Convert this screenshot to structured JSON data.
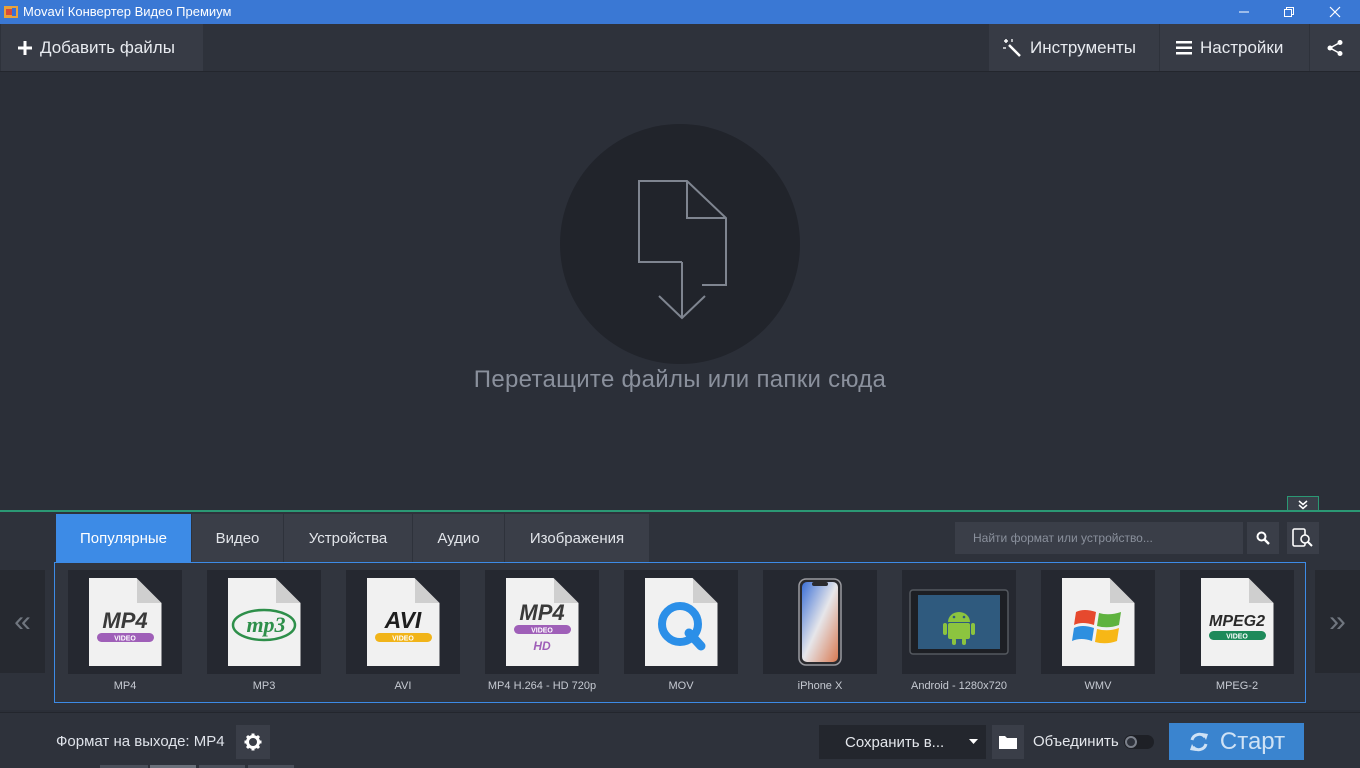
{
  "window": {
    "title": "Movavi Конвертер Видео Премиум"
  },
  "toolbar": {
    "add_files_label": "Добавить файлы",
    "tools_label": "Инструменты",
    "settings_label": "Настройки"
  },
  "drop_zone": {
    "hint": "Перетащите файлы или папки сюда"
  },
  "format_panel": {
    "tabs": [
      {
        "label": "Популярные",
        "active": true
      },
      {
        "label": "Видео",
        "active": false
      },
      {
        "label": "Устройства",
        "active": false
      },
      {
        "label": "Аудио",
        "active": false
      },
      {
        "label": "Изображения",
        "active": false
      }
    ],
    "search_placeholder": "Найти формат или устройство...",
    "prev_arrow": "«",
    "next_arrow": "»",
    "formats": [
      {
        "label": "MP4",
        "icon": "mp4-icon",
        "badge": "MP4",
        "sub": "VIDEO"
      },
      {
        "label": "MP3",
        "icon": "mp3-icon",
        "badge": "mp3"
      },
      {
        "label": "AVI",
        "icon": "avi-icon",
        "badge": "AVI",
        "sub": "VIDEO"
      },
      {
        "label": "MP4 H.264 - HD 720p",
        "icon": "mp4-hd-icon",
        "badge": "MP4",
        "sub": "VIDEO",
        "sub2": "HD"
      },
      {
        "label": "MOV",
        "icon": "quicktime-icon"
      },
      {
        "label": "iPhone X",
        "icon": "iphone-icon"
      },
      {
        "label": "Android - 1280x720",
        "icon": "android-tablet-icon"
      },
      {
        "label": "WMV",
        "icon": "windows-logo-icon"
      },
      {
        "label": "MPEG-2",
        "icon": "mpeg2-icon",
        "badge": "MPEG2",
        "sub": "VIDEO"
      }
    ]
  },
  "bottom_bar": {
    "output_format_label": "Формат на выходе: MP4",
    "save_to_label": "Сохранить в...",
    "merge_label": "Объединить",
    "merge_enabled": false,
    "start_label": "Старт"
  },
  "colors": {
    "titlebar": "#3a78d4",
    "accent": "#3d8be6",
    "panel_border": "#2b9874",
    "start_button": "#3a84cf"
  }
}
